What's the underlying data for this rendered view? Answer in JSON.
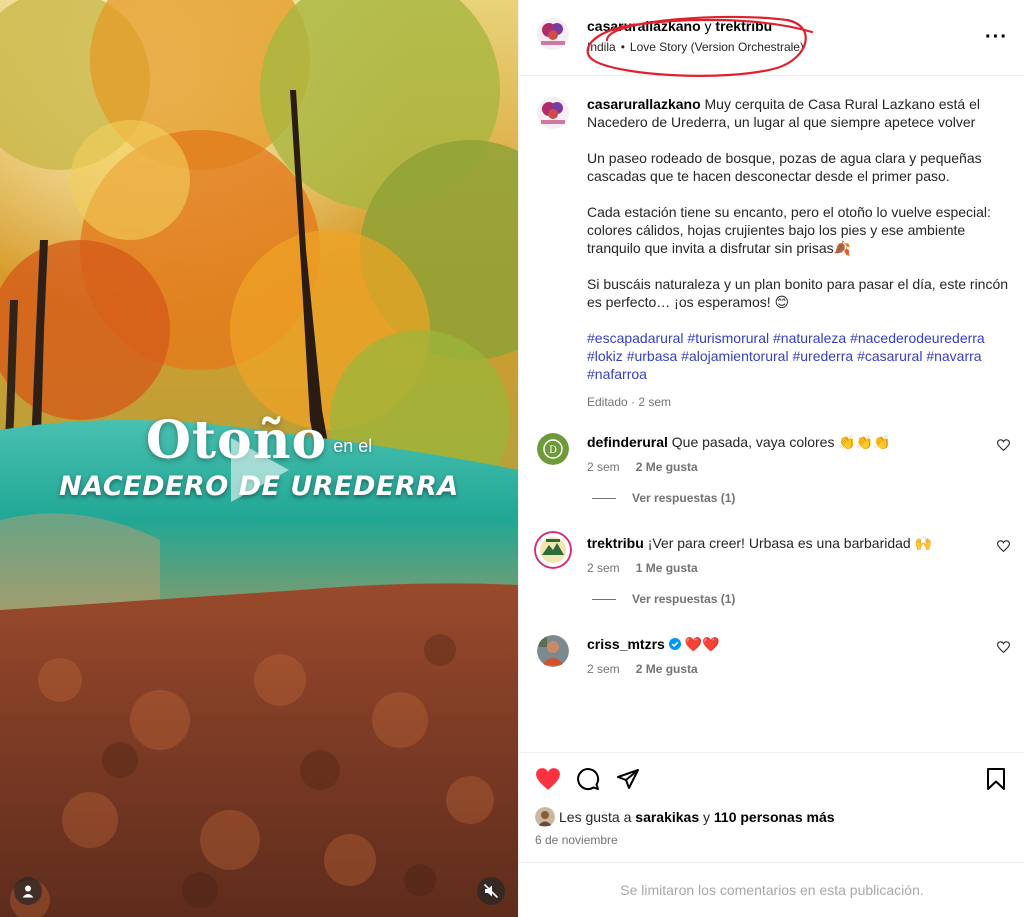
{
  "media": {
    "overlay_title": "Otoño",
    "overlay_connector": "en el",
    "overlay_place": "NACEDERO DE UREDERRA"
  },
  "post": {
    "author": "casarurallazkano",
    "collab_connector": "y",
    "collaborator": "trektribu",
    "audio_artist": "Indila",
    "audio_separator": "•",
    "audio_title": "Love Story (Version Orchestrale)"
  },
  "caption": {
    "username": "casarurallazkano",
    "p1": "Muy cerquita de Casa Rural Lazkano está el Nacedero de Urederra, un lugar al que siempre apetece volver",
    "p2": "Un paseo rodeado de bosque, pozas de agua clara y pequeñas cascadas que te hacen desconectar desde el primer paso.",
    "p3": "Cada estación tiene su encanto, pero el otoño lo vuelve especial: colores cálidos, hojas crujientes bajo los pies y ese ambiente tranquilo que invita a disfrutar sin prisas🍂",
    "p4": "Si buscáis naturaleza y un plan bonito para pasar el día, este rincón es perfecto… ¡os esperamos! 😊",
    "hashtags": [
      "#escapadarural",
      "#turismorural",
      "#naturaleza",
      "#nacederodeurederra",
      "#lokiz",
      "#urbasa",
      "#alojamientorural",
      "#urederra",
      "#casarural",
      "#navarra",
      "#nafarroa"
    ],
    "meta": "Editado · 2 sem"
  },
  "comments": [
    {
      "username": "definderural",
      "text": "Que pasada, vaya colores 👏👏👏",
      "time": "2 sem",
      "likes": "2 Me gusta",
      "replies": "Ver respuestas (1)"
    },
    {
      "username": "trektribu",
      "text": "¡Ver para creer! Urbasa es una barbaridad 🙌",
      "time": "2 sem",
      "likes": "1 Me gusta",
      "replies": "Ver respuestas (1)"
    },
    {
      "username": "criss_mtzrs",
      "text": "❤️❤️",
      "time": "2 sem",
      "likes": "2 Me gusta",
      "verified": true
    }
  ],
  "likes": {
    "prefix": "Les gusta a",
    "first_user": "sarakikas",
    "connector": "y",
    "others": "110 personas más"
  },
  "date": "6 de noviembre",
  "comments_limited": "Se limitaron los comentarios en esta publicación.",
  "colors": {
    "like_red": "#ff3040",
    "hashtag_blue": "#3740c0",
    "annotation_red": "#e0202a",
    "muted_text": "#737373"
  },
  "icons": {
    "like": "heart-icon",
    "comment": "comment-bubble-icon",
    "share": "paper-plane-icon",
    "save": "bookmark-icon",
    "more": "more-options-icon",
    "mute": "muted-speaker-icon",
    "user_tag": "user-tag-icon"
  }
}
